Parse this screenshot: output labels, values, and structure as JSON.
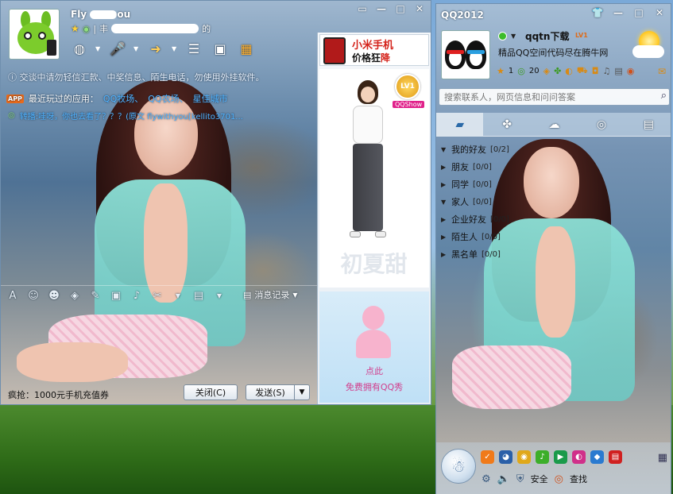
{
  "chat_window": {
    "controls": {
      "restore": "▭",
      "minimize": "—",
      "maximize": "□",
      "close": "✕"
    },
    "contact_name_start": "Fly",
    "contact_name_end": "ou",
    "status_prefix": "丰",
    "status_suffix": "的",
    "toolbar_icons": [
      "webcam-icon",
      "microphone-icon",
      "file-transfer-icon",
      "app-icon",
      "remote-desktop-icon",
      "more-apps-icon"
    ],
    "notice": "交谈中请勿轻信汇款、中奖信息、陌生电话，勿使用外挂软件。",
    "recent_apps": {
      "badge": "APP",
      "label": "最近玩过的应用：",
      "links": [
        "QQ牧场、",
        "QQ农场、",
        "星佳城市"
      ]
    },
    "recent_message": {
      "prefix": "",
      "highlight": "转播:哇呀，你也去看了？？？(原文 flywithyou[kellito3701...",
      "text": ""
    },
    "edit_tools": [
      "font-icon",
      "emoticon-icon",
      "magic-emoticon-icon",
      "shake-icon",
      "handwriting-icon",
      "image-icon",
      "music-icon",
      "screenshot-icon",
      "schedule-icon"
    ],
    "message_record": "消息记录",
    "promo": "疯抢：1000元手机充值券",
    "close_button": "关闭(C)",
    "send_button": "发送(S)",
    "ad": {
      "brand": "小米手机",
      "slogan_normal": "价格狂",
      "slogan_hot": "降"
    },
    "qqshow": {
      "level": "LV1",
      "tag": "QQShow",
      "free_line1": "点此",
      "free_line2": "免费拥有QQ秀"
    },
    "watermark": "初夏甜"
  },
  "qq_panel": {
    "title": "QQ2012",
    "controls": {
      "skin": "👕",
      "minimize": "—",
      "maximize": "□",
      "close": "✕"
    },
    "nickname": "qqtn下载",
    "level_tag": "LV1",
    "signature": "精品QQ空间代码尽在腾牛网",
    "stats": {
      "level": "1",
      "messages": "20"
    },
    "search_placeholder": "搜索联系人，网页信息和问问答案",
    "tabs": [
      "contacts-tab",
      "groups-tab",
      "discussion-tab",
      "qzone-tab",
      "recent-tab"
    ],
    "groups": [
      {
        "name": "我的好友",
        "count": "[0/2]",
        "expanded": true
      },
      {
        "name": "朋友",
        "count": "[0/0]",
        "expanded": false
      },
      {
        "name": "同学",
        "count": "[0/0]",
        "expanded": false
      },
      {
        "name": "家人",
        "count": "[0/0]",
        "expanded": true
      },
      {
        "name": "企业好友",
        "count": "[0/0]",
        "expanded": false
      },
      {
        "name": "陌生人",
        "count": "[0/0]",
        "expanded": false
      },
      {
        "name": "黑名单",
        "count": "[0/0]",
        "expanded": false
      }
    ],
    "bottom": {
      "security": "安全",
      "find": "查找"
    },
    "colors": {
      "online": "#3cbc2a",
      "accent": "#2b6aa8"
    }
  }
}
